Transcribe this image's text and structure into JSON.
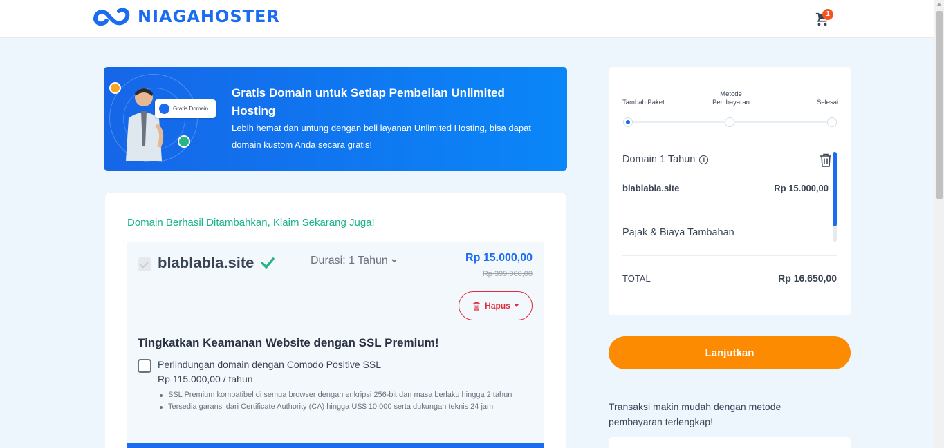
{
  "header": {
    "brand": "NIAGAHOSTER",
    "cart_count": "1"
  },
  "banner": {
    "title": "Gratis Domain untuk Setiap Pembelian Unlimited Hosting",
    "subtitle": "Lebih hemat dan untung dengan beli layanan Unlimited Hosting, bisa dapat domain kustom Anda secara gratis!",
    "card_label": "Gratis Domain"
  },
  "domain_section": {
    "success_message": "Domain Berhasil Ditambahkan, Klaim Sekarang Juga!",
    "domain_name": "blablabla.site",
    "duration_label": "Durasi: 1 Tahun",
    "price": "Rp 15.000,00",
    "original_price": "Rp 399.000,00",
    "remove_label": "Hapus"
  },
  "ssl": {
    "title": "Tingkatkan Keamanan Website dengan SSL Premium!",
    "option_label": "Perlindungan domain dengan Comodo Positive SSL",
    "option_price": "Rp 115.000,00 / tahun",
    "features": [
      "SSL Premium kompatibel di semua browser dengan enkripsi 256-bit dan masa berlaku hingga 2 tahun",
      "Tersedia garansi dari Certificate Authority (CA) hingga US$ 10,000 serta dukungan teknis 24 jam"
    ]
  },
  "summary": {
    "steps": [
      "Tambah Paket",
      "Metode Pembayaran",
      "Selesai"
    ],
    "active_step": 0,
    "item_title": "Domain 1 Tahun",
    "item_domain": "blablabla.site",
    "item_price": "Rp 15.000,00",
    "tax_label": "Pajak & Biaya Tambahan",
    "total_label": "TOTAL",
    "total_value": "Rp 16.650,00"
  },
  "sidebar": {
    "continue_label": "Lanjutkan",
    "payment_note": "Transaksi makin mudah dengan metode pembayaran terlengkap!"
  },
  "colors": {
    "brand_blue": "#1a6cf0",
    "success_green": "#19b38c",
    "danger_red": "#e02b3a",
    "cta_orange": "#fd8b02"
  }
}
